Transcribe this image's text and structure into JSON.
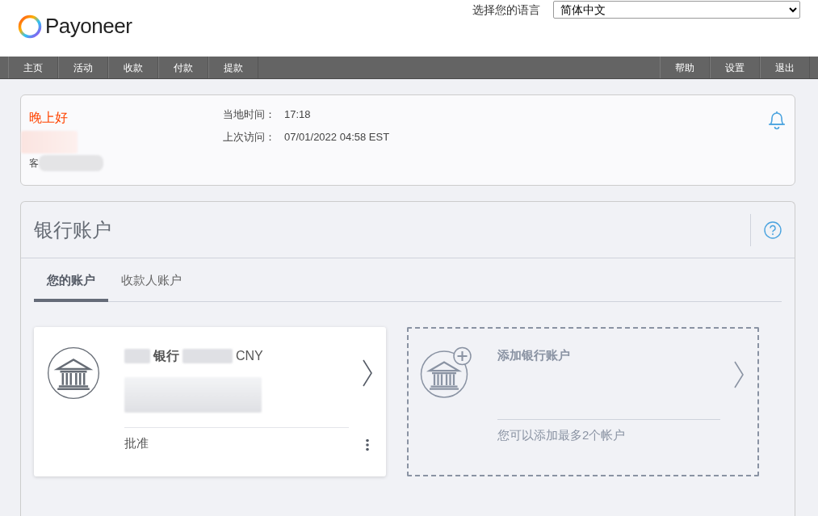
{
  "header": {
    "logo": "Payoneer",
    "language_label": "选择您的语言",
    "language_value": "简体中文"
  },
  "nav": {
    "left": [
      {
        "label": "主页"
      },
      {
        "label": "活动"
      },
      {
        "label": "收款"
      },
      {
        "label": "付款"
      },
      {
        "label": "提款"
      }
    ],
    "right": [
      {
        "label": "帮助"
      },
      {
        "label": "设置"
      },
      {
        "label": "退出"
      }
    ]
  },
  "greeting": {
    "title": "晚上好",
    "customer_label": "客",
    "local_time_label": "当地时间：",
    "local_time": "17:18",
    "last_visit_label": "上次访问：",
    "last_visit": "07/01/2022 04:58 EST"
  },
  "bank": {
    "title": "银行账户",
    "tabs": [
      {
        "label": "您的账户",
        "selected": true
      },
      {
        "label": "收款人账户",
        "selected": false
      }
    ],
    "accounts": [
      {
        "kind": "account",
        "bank_name": "银行",
        "currency": "CNY",
        "status": "批准"
      },
      {
        "kind": "add",
        "title": "添加银行账户",
        "note": "您可以添加最多2个帐户"
      }
    ]
  }
}
